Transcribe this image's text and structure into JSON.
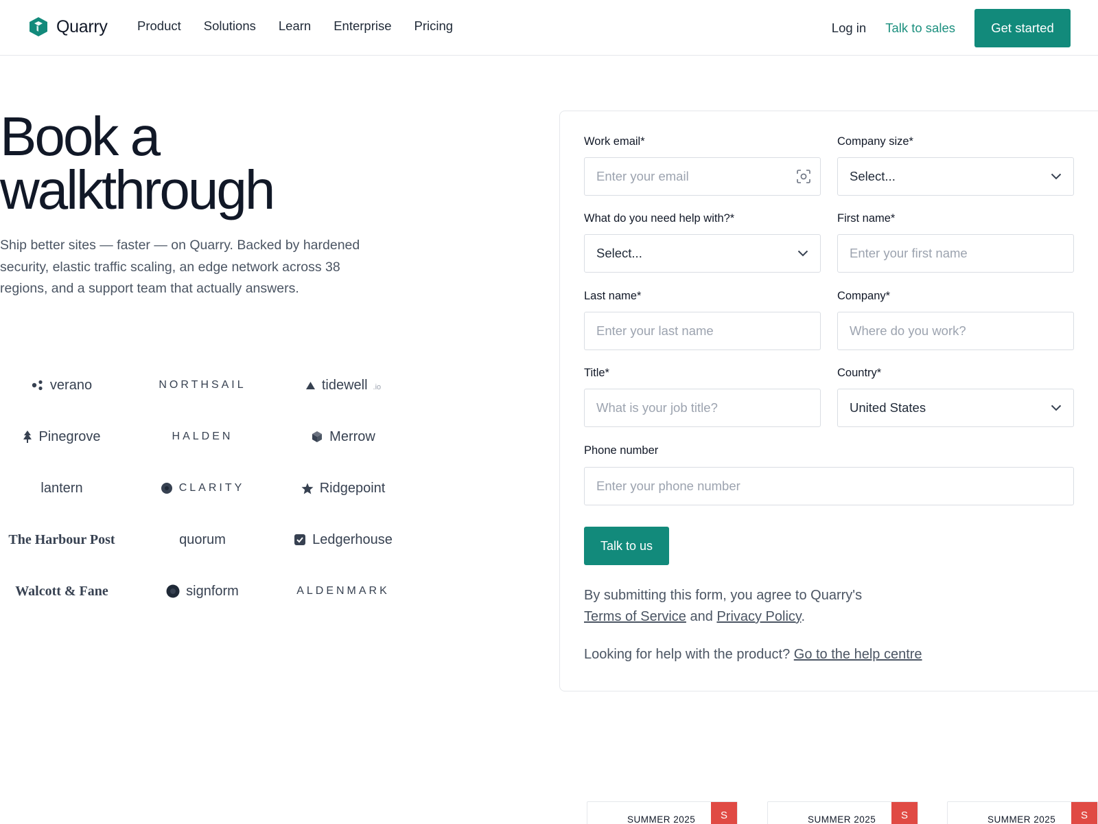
{
  "nav": {
    "brand": "Quarry",
    "links": [
      "Product",
      "Solutions",
      "Learn",
      "Enterprise",
      "Pricing"
    ],
    "login": "Log in",
    "talk_sales": "Talk to sales",
    "get_started": "Get started"
  },
  "hero": {
    "title_line1": "Book a",
    "title_line2": "walkthrough",
    "subtitle": "Ship better sites — faster — on Quarry. Backed by hardened security, elastic traffic scaling, an edge network across 38 regions, and a support team that actually answers."
  },
  "brands": [
    {
      "name": "verano",
      "icon": "dots-icon"
    },
    {
      "name": "NORTHSAIL",
      "icon": ""
    },
    {
      "name": "tidewell",
      "suffix": ".io",
      "icon": "triangle-icon"
    },
    {
      "name": "Pinegrove",
      "icon": "tree-icon"
    },
    {
      "name": "HALDEN",
      "icon": ""
    },
    {
      "name": "Merrow",
      "icon": "cube-icon"
    },
    {
      "name": "lantern",
      "icon": ""
    },
    {
      "name": "CLARITY",
      "icon": "circle-icon"
    },
    {
      "name": "Ridgepoint",
      "icon": "star-icon"
    },
    {
      "name": "The Harbour Post",
      "icon": ""
    },
    {
      "name": "quorum",
      "icon": ""
    },
    {
      "name": "Ledgerhouse",
      "icon": "checkbox-icon"
    },
    {
      "name": "Walcott & Fane",
      "icon": ""
    },
    {
      "name": "signform",
      "icon": "circle-icon"
    },
    {
      "name": "ALDENMARK",
      "icon": ""
    }
  ],
  "form": {
    "work_email": {
      "label": "Work email*",
      "placeholder": "Enter your email"
    },
    "company_size": {
      "label": "Company size*",
      "value": "Select..."
    },
    "help_with": {
      "label": "What do you need help with?*",
      "value": "Select..."
    },
    "first_name": {
      "label": "First name*",
      "placeholder": "Enter your first name"
    },
    "last_name": {
      "label": "Last name*",
      "placeholder": "Enter your last name"
    },
    "company": {
      "label": "Company*",
      "placeholder": "Where do you work?"
    },
    "title": {
      "label": "Title*",
      "placeholder": "What is your job title?"
    },
    "country": {
      "label": "Country*",
      "value": "United States"
    },
    "phone": {
      "label": "Phone number",
      "placeholder": "Enter your phone number"
    },
    "submit": "Talk to us",
    "legal_prefix": "By submitting this form, you agree to Quarry's",
    "terms": "Terms of Service",
    "legal_and": "and",
    "privacy": "Privacy Policy",
    "legal_end": ".",
    "help_prefix": "Looking for help with the product?",
    "help_link": "Go to the help centre"
  },
  "bottom_cards": [
    {
      "title": "SUMMER 2025",
      "badge": "S"
    },
    {
      "title": "SUMMER 2025",
      "badge": "S"
    },
    {
      "title": "SUMMER 2025",
      "badge": "S"
    }
  ],
  "colors": {
    "accent": "#128a7b",
    "link": "#1b8f7e",
    "badge": "#e04a44"
  }
}
